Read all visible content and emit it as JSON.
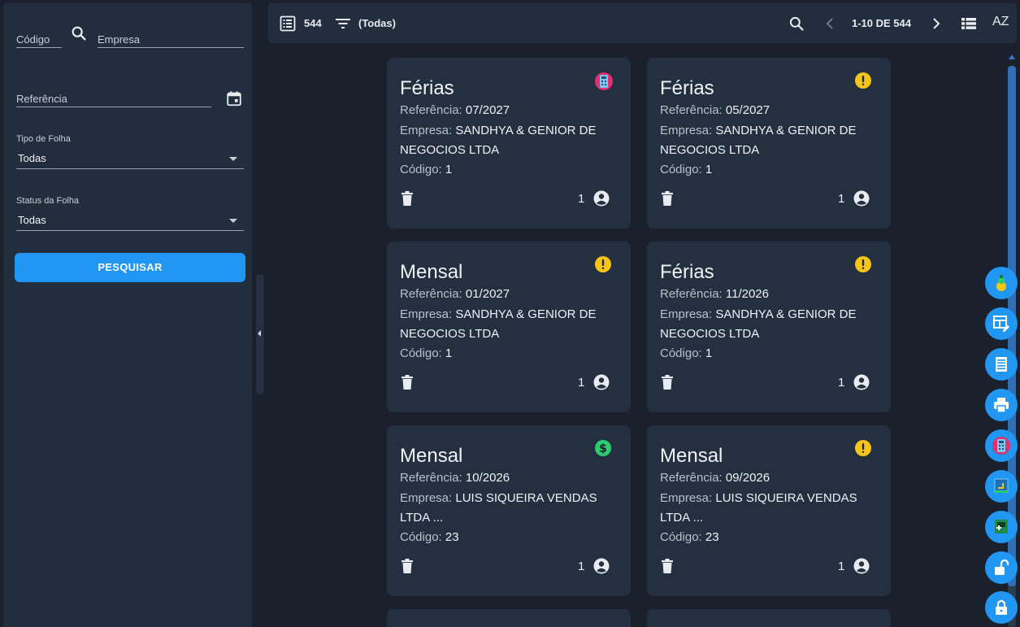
{
  "filters": {
    "codigo_label": "Código",
    "empresa_label": "Empresa",
    "referencia_label": "Referência",
    "tipo_folha_label": "Tipo de Folha",
    "tipo_folha_value": "Todas",
    "status_folha_label": "Status da Folha",
    "status_folha_value": "Todas",
    "search_button": "PESQUISAR"
  },
  "toolbar": {
    "count": "544",
    "filter_value": "(Todas)",
    "pagination": "1-10 DE 544",
    "sort_label": "AZ"
  },
  "cards": [
    {
      "title": "Férias",
      "ref_label": "Referência: ",
      "ref": "07/2027",
      "emp_label": "Empresa: ",
      "emp": "SANDHYA & GENIOR DE NEGOCIOS LTDA",
      "cod_label": "Código: ",
      "cod": "1",
      "count": "1",
      "status": "calculator-icon"
    },
    {
      "title": "Férias",
      "ref_label": "Referência: ",
      "ref": "05/2027",
      "emp_label": "Empresa: ",
      "emp": "SANDHYA & GENIOR DE NEGOCIOS LTDA",
      "cod_label": "Código: ",
      "cod": "1",
      "count": "1",
      "status": "warning-icon"
    },
    {
      "title": "Mensal",
      "ref_label": "Referência: ",
      "ref": "01/2027",
      "emp_label": "Empresa: ",
      "emp": "SANDHYA & GENIOR DE NEGOCIOS LTDA",
      "cod_label": "Código: ",
      "cod": "1",
      "count": "1",
      "status": "warning-icon"
    },
    {
      "title": "Férias",
      "ref_label": "Referência: ",
      "ref": "11/2026",
      "emp_label": "Empresa: ",
      "emp": "SANDHYA & GENIOR DE NEGOCIOS LTDA",
      "cod_label": "Código: ",
      "cod": "1",
      "count": "1",
      "status": "warning-icon"
    },
    {
      "title": "Mensal",
      "ref_label": "Referência: ",
      "ref": "10/2026",
      "emp_label": "Empresa: ",
      "emp": "LUIS SIQUEIRA VENDAS LTDA ...",
      "cod_label": "Código: ",
      "cod": "23",
      "count": "1",
      "status": "dollar-icon"
    },
    {
      "title": "Mensal",
      "ref_label": "Referência: ",
      "ref": "09/2026",
      "emp_label": "Empresa: ",
      "emp": "LUIS SIQUEIRA VENDAS LTDA ...",
      "cod_label": "Código: ",
      "cod": "23",
      "count": "1",
      "status": "warning-icon"
    }
  ],
  "colors": {
    "accent": "#2196f3",
    "warning": "#f5c518",
    "money": "#2ecc71",
    "calculator": "#e0306e"
  },
  "fabs": [
    "coin-stack-icon",
    "table-edit-icon",
    "document-list-icon",
    "print-icon",
    "calculator-icon",
    "monitor-icon",
    "add-box-icon",
    "unlock-icon",
    "lock-icon"
  ]
}
